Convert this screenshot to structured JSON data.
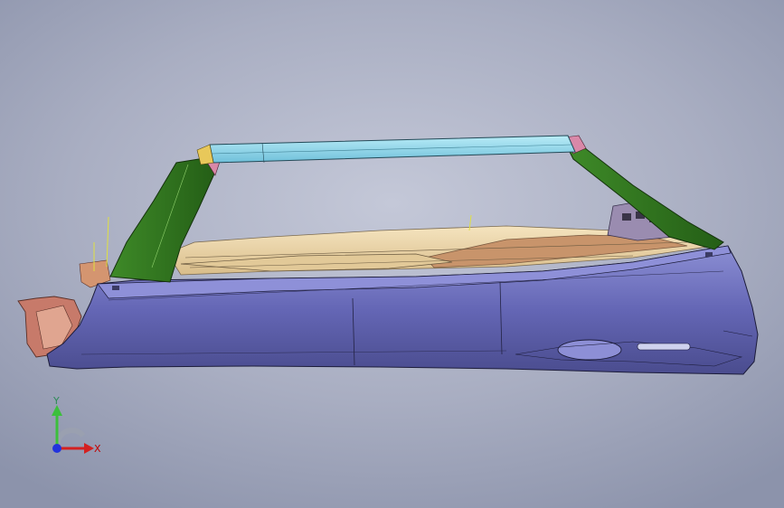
{
  "viewport": {
    "background_top": "#c4c8d8",
    "background_bottom": "#8c93ab"
  },
  "model": {
    "part_colors": {
      "body_panel": "#6b6cb8",
      "top_rail": "#8fd6ea",
      "side_pillars": "#2f7a1f",
      "interior_trim": "#e8d3a6",
      "floor_panel": "#c8946b",
      "end_bracket": "#c77a6a"
    }
  },
  "triad": {
    "x_label": "X",
    "y_label": "Y",
    "x_color": "#d42020",
    "y_color": "#3cbf3c",
    "origin_color": "#2233dd"
  }
}
